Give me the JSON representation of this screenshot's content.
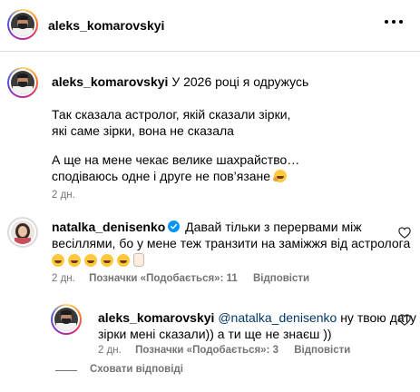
{
  "header": {
    "username": "aleks_komarovskyi"
  },
  "caption": {
    "username": "aleks_komarovskyi",
    "first_line": "У 2026 році я одружусь",
    "para1_line1": "Так сказала астролог, якій сказали зірки,",
    "para1_line2": "які саме зірки, вона не сказала",
    "para2_line1": "А ще на мене чекає велике шахрайство…",
    "para2_line2": "сподіваюсь одне і друге не пов’язане",
    "time": "2 дн."
  },
  "comment": {
    "username": "natalka_denisenko",
    "line1": "Давай тільки з перервами між",
    "line2": "весіллями, бо у мене теж транзити на заміжжя від астролога",
    "emojis": [
      "laughing-crying",
      "laughing-crying",
      "laughing-crying",
      "laughing-crying",
      "laughing-crying",
      "victory-hand"
    ],
    "time": "2 дн.",
    "likes_label": "Позначки «Подобається»: 11",
    "reply_label": "Відповісти"
  },
  "reply": {
    "username": "aleks_komarovskyi",
    "mention": "@natalka_denisenko",
    "line1_rest": " ну твою дату",
    "line2": "зірки мені сказали)) а ти ще не знаєш ))",
    "time": "2 дн.",
    "likes_label": "Позначки «Подобається»: 3",
    "reply_label": "Відповісти"
  },
  "hide_replies_label": "Сховати відповіді",
  "colors": {
    "verified": "#0095f6",
    "meta": "#737373",
    "link": "#00376b",
    "divider": "#dbdbdb"
  }
}
